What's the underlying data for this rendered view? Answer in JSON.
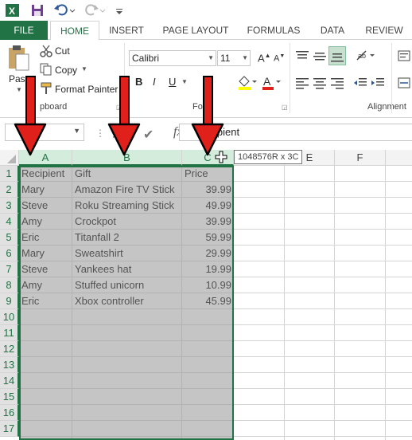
{
  "qat": {
    "icons": [
      "excel-icon",
      "save-icon",
      "undo-icon",
      "redo-icon",
      "customize-icon"
    ]
  },
  "tabs": [
    "FILE",
    "HOME",
    "INSERT",
    "PAGE LAYOUT",
    "FORMULAS",
    "DATA",
    "REVIEW"
  ],
  "ribbon": {
    "paste_label": "Paste",
    "cut_label": "Cut",
    "copy_label": "Copy",
    "format_painter_label": "Format Painter",
    "clipboard_group": "pboard",
    "font_group": "Fo",
    "alignment_group": "Alignment",
    "font_name": "Calibri",
    "font_size": "11"
  },
  "formula_bar": {
    "fx": "fx",
    "content": "ipient"
  },
  "tooltip": "1048576R x 3C",
  "columns": [
    "A",
    "B",
    "C",
    "D",
    "E",
    "F"
  ],
  "rows": [
    "1",
    "2",
    "3",
    "4",
    "5",
    "6",
    "7",
    "8",
    "9",
    "10",
    "11",
    "12",
    "13",
    "14",
    "15",
    "16",
    "17"
  ],
  "table": {
    "headers": [
      "Recipient",
      "Gift",
      "Price"
    ],
    "rows": [
      [
        "Mary",
        "Amazon Fire TV Stick",
        "39.99"
      ],
      [
        "Steve",
        "Roku Streaming Stick",
        "49.99"
      ],
      [
        "Amy",
        "Crockpot",
        "39.99"
      ],
      [
        "Eric",
        "Titanfall 2",
        "59.99"
      ],
      [
        "Mary",
        "Sweatshirt",
        "29.99"
      ],
      [
        "Steve",
        "Yankees hat",
        "19.99"
      ],
      [
        "Amy",
        "Stuffed unicorn",
        "10.99"
      ],
      [
        "Eric",
        "Xbox controller",
        "45.99"
      ]
    ]
  },
  "colors": {
    "excel_green": "#217346",
    "arrow_red": "#e0201b",
    "selection": "#9a9a9a"
  }
}
